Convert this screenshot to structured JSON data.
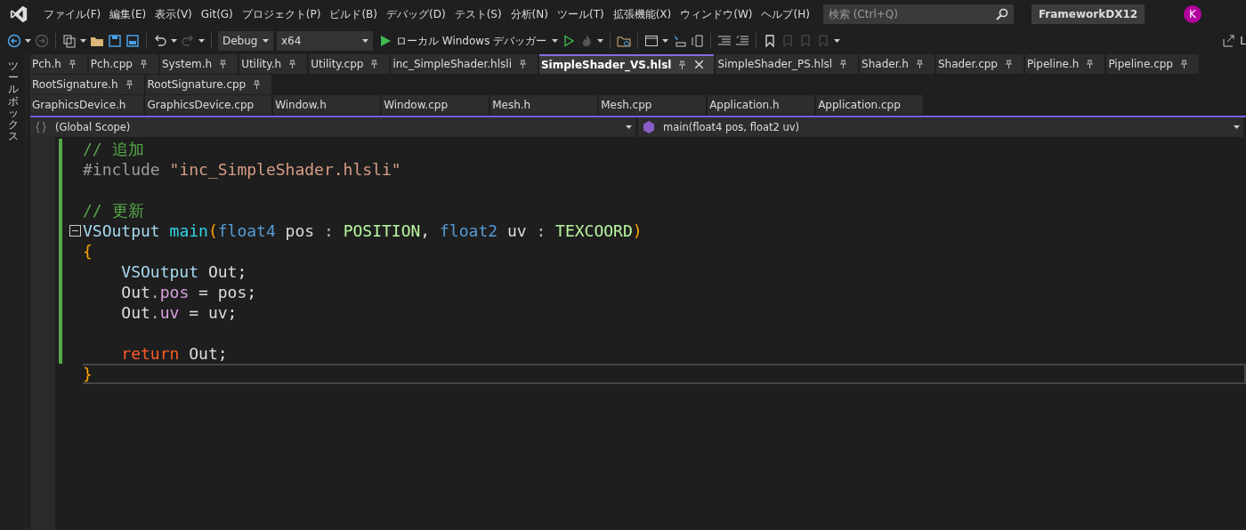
{
  "menu": [
    "ファイル(F)",
    "編集(E)",
    "表示(V)",
    "Git(G)",
    "プロジェクト(P)",
    "ビルド(B)",
    "デバッグ(D)",
    "テスト(S)",
    "分析(N)",
    "ツール(T)",
    "拡張機能(X)",
    "ウィンドウ(W)",
    "ヘルプ(H)"
  ],
  "search": {
    "placeholder": "検索 (Ctrl+Q)"
  },
  "solution_name": "FrameworkDX12",
  "avatar": "K",
  "toolbar": {
    "configuration": "Debug",
    "platform": "x64",
    "debugger": "ローカル Windows デバッガー",
    "live_share": "L"
  },
  "toolbox_label": "ツールボックス",
  "tab_rows": [
    [
      {
        "label": "Pch.h",
        "pinned": true,
        "selected": false
      },
      {
        "label": "Pch.cpp",
        "pinned": true,
        "selected": false
      },
      {
        "label": "System.h",
        "pinned": true,
        "selected": false
      },
      {
        "label": "Utility.h",
        "pinned": true,
        "selected": false
      },
      {
        "label": "Utility.cpp",
        "pinned": true,
        "selected": false
      },
      {
        "label": "inc_SimpleShader.hlsli",
        "pinned": true,
        "selected": false
      },
      {
        "label": "SimpleShader_VS.hlsl",
        "pinned": true,
        "selected": true
      },
      {
        "label": "SimpleShader_PS.hlsl",
        "pinned": true,
        "selected": false
      },
      {
        "label": "Shader.h",
        "pinned": true,
        "selected": false
      },
      {
        "label": "Shader.cpp",
        "pinned": true,
        "selected": false
      },
      {
        "label": "Pipeline.h",
        "pinned": true,
        "selected": false
      },
      {
        "label": "Pipeline.cpp",
        "pinned": true,
        "selected": false
      }
    ],
    [
      {
        "label": "RootSignature.h",
        "pinned": true,
        "selected": false
      },
      {
        "label": "RootSignature.cpp",
        "pinned": true,
        "selected": false
      }
    ],
    [
      {
        "label": "GraphicsDevice.h",
        "pinned": false,
        "selected": false
      },
      {
        "label": "GraphicsDevice.cpp",
        "pinned": false,
        "selected": false
      },
      {
        "label": "Window.h",
        "pinned": false,
        "selected": false
      },
      {
        "label": "Window.cpp",
        "pinned": false,
        "selected": false
      },
      {
        "label": "Mesh.h",
        "pinned": false,
        "selected": false
      },
      {
        "label": "Mesh.cpp",
        "pinned": false,
        "selected": false
      },
      {
        "label": "Application.h",
        "pinned": false,
        "selected": false
      },
      {
        "label": "Application.cpp",
        "pinned": false,
        "selected": false
      }
    ]
  ],
  "navigation": {
    "scope": "(Global Scope)",
    "member": "main(float4 pos, float2 uv)"
  },
  "code_lines": [
    {
      "changed": true,
      "current": false,
      "collapsible": false,
      "tokens": [
        {
          "kind": "comment",
          "text": "// 追加"
        }
      ]
    },
    {
      "changed": true,
      "current": false,
      "collapsible": false,
      "tokens": [
        {
          "kind": "directive",
          "text": "#include "
        },
        {
          "kind": "string",
          "text": "\"inc_SimpleShader.hlsli\""
        }
      ]
    },
    {
      "changed": true,
      "current": false,
      "collapsible": false
    },
    {
      "changed": true,
      "current": false,
      "collapsible": false,
      "tokens": [
        {
          "kind": "comment",
          "text": "// 更新"
        }
      ]
    },
    {
      "changed": true,
      "current": false,
      "collapsible": true,
      "tokens": [
        {
          "kind": "type",
          "text": "VSOutput"
        },
        {
          "kind": "func",
          "text": " main"
        },
        {
          "kind": "paren",
          "text": "("
        },
        {
          "kind": "keyword",
          "text": "float4"
        },
        {
          "kind": "plain",
          "text": " pos "
        },
        {
          "kind": "punct",
          "text": ":"
        },
        {
          "kind": "semantic",
          "text": " POSITION"
        },
        {
          "kind": "plain",
          "text": ", "
        },
        {
          "kind": "keyword",
          "text": "float2"
        },
        {
          "kind": "plain",
          "text": " uv "
        },
        {
          "kind": "punct",
          "text": ":"
        },
        {
          "kind": "semantic",
          "text": " TEXCOORD"
        },
        {
          "kind": "paren",
          "text": ")"
        }
      ]
    },
    {
      "changed": true,
      "current": false,
      "collapsible": false,
      "tokens": [
        {
          "kind": "brace",
          "text": "{"
        }
      ]
    },
    {
      "changed": true,
      "current": false,
      "collapsible": false,
      "tokens": [
        {
          "kind": "type",
          "text": "    VSOutput"
        },
        {
          "kind": "plain",
          "text": " Out;"
        }
      ]
    },
    {
      "changed": true,
      "current": false,
      "collapsible": false,
      "tokens": [
        {
          "kind": "plain",
          "text": "    Out"
        },
        {
          "kind": "punct",
          "text": "."
        },
        {
          "kind": "member",
          "text": "pos"
        },
        {
          "kind": "plain",
          "text": " = pos;"
        }
      ]
    },
    {
      "changed": true,
      "current": false,
      "collapsible": false,
      "tokens": [
        {
          "kind": "plain",
          "text": "    Out"
        },
        {
          "kind": "punct",
          "text": "."
        },
        {
          "kind": "member",
          "text": "uv"
        },
        {
          "kind": "plain",
          "text": " = uv;"
        }
      ]
    },
    {
      "changed": true,
      "current": false,
      "collapsible": false
    },
    {
      "changed": true,
      "current": false,
      "collapsible": false,
      "tokens": [
        {
          "kind": "control",
          "text": "    return"
        },
        {
          "kind": "plain",
          "text": " Out;"
        }
      ]
    },
    {
      "changed": false,
      "current": true,
      "collapsible": false,
      "tokens": [
        {
          "kind": "brace",
          "text": "}"
        }
      ]
    }
  ]
}
